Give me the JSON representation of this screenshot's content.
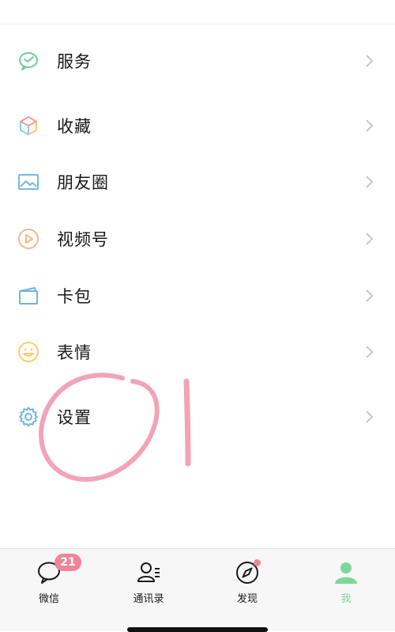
{
  "menu": {
    "items": [
      {
        "label": "服务",
        "icon": "wechat-pay-icon"
      },
      {
        "label": "收藏",
        "icon": "favorites-cube-icon"
      },
      {
        "label": "朋友圈",
        "icon": "moments-image-icon"
      },
      {
        "label": "视频号",
        "icon": "channels-play-icon"
      },
      {
        "label": "卡包",
        "icon": "card-wallet-icon"
      },
      {
        "label": "表情",
        "icon": "sticker-smile-icon"
      },
      {
        "label": "设置",
        "icon": "settings-gear-icon"
      }
    ]
  },
  "tabbar": {
    "tabs": [
      {
        "label": "微信",
        "icon": "chat-bubble-icon",
        "badge": "21"
      },
      {
        "label": "通讯录",
        "icon": "contacts-icon"
      },
      {
        "label": "发现",
        "icon": "compass-icon",
        "dot": true
      },
      {
        "label": "我",
        "icon": "person-icon",
        "active": true
      }
    ]
  },
  "colors": {
    "accent_green": "#7fd69a",
    "badge_pink": "#f0859a",
    "annotation_pink": "#f2a3b8",
    "chevron_gray": "#c7c7c7"
  }
}
